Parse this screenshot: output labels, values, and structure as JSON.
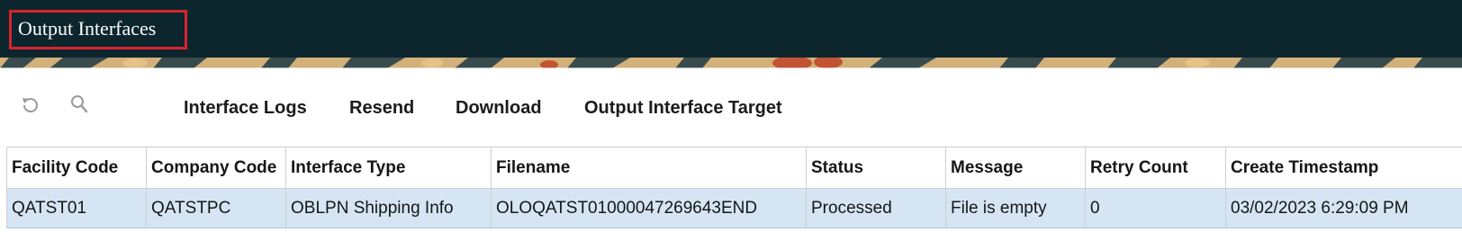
{
  "header": {
    "title": "Output Interfaces"
  },
  "toolbar": {
    "icons": [
      {
        "name": "refresh-icon"
      },
      {
        "name": "search-icon"
      }
    ],
    "actions": [
      {
        "label": "Interface Logs"
      },
      {
        "label": "Resend"
      },
      {
        "label": "Download"
      },
      {
        "label": "Output Interface Target"
      }
    ]
  },
  "table": {
    "columns": [
      "Facility Code",
      "Company Code",
      "Interface Type",
      "Filename",
      "Status",
      "Message",
      "Retry Count",
      "Create Timestamp"
    ],
    "rows": [
      {
        "facility_code": "QATST01",
        "company_code": "QATSTPC",
        "interface_type": "OBLPN Shipping Info",
        "filename": "OLOQATST01000047269643END",
        "status": "Processed",
        "message": "File is empty",
        "retry_count": "0",
        "create_timestamp": "03/02/2023 6:29:09 PM"
      }
    ]
  },
  "colors": {
    "header_bg": "#0d262d",
    "highlight_border": "#d9232e",
    "selected_row_bg": "#d5e5f4"
  }
}
